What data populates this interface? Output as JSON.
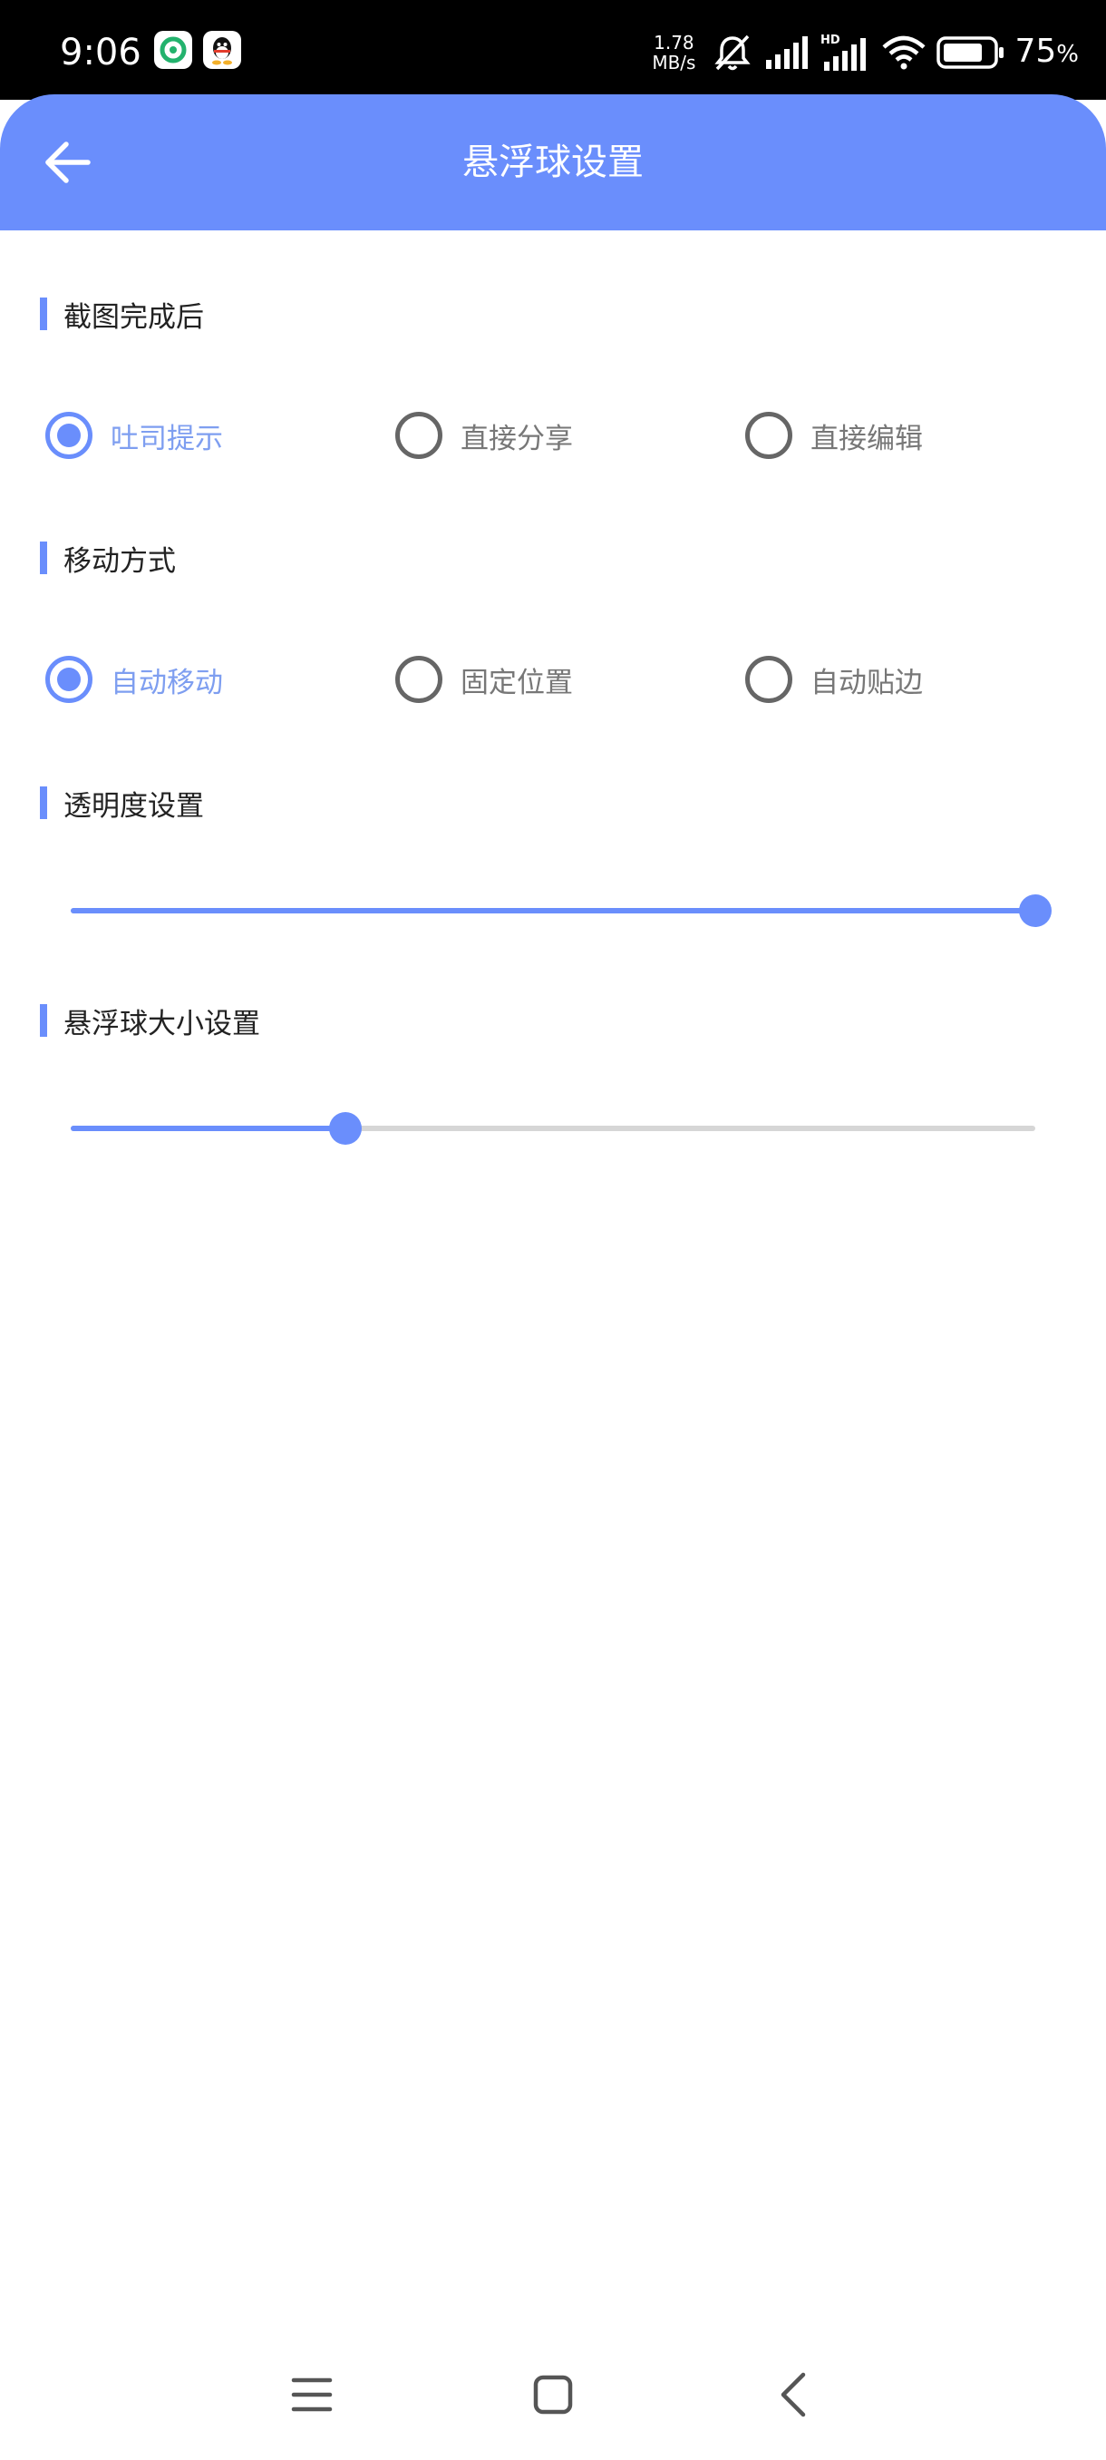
{
  "status_bar": {
    "time": "9:06",
    "net_speed_value": "1.78",
    "net_speed_unit": "MB/s",
    "battery_level": "75",
    "battery_unit": "%",
    "battery_fraction": 0.75,
    "icons": [
      "app-icon-green",
      "qq-icon",
      "mute-bell-icon",
      "signal-icon",
      "hd-signal-icon",
      "wifi-icon",
      "battery-icon"
    ]
  },
  "app_bar": {
    "title": "悬浮球设置",
    "back_icon": "back-arrow-icon"
  },
  "sections": {
    "after_screenshot": {
      "title": "截图完成后",
      "options": [
        "吐司提示",
        "直接分享",
        "直接编辑"
      ],
      "selected": "吐司提示"
    },
    "move_mode": {
      "title": "移动方式",
      "options": [
        "自动移动",
        "固定位置",
        "自动贴边"
      ],
      "selected": "自动移动"
    },
    "opacity": {
      "title": "透明度设置",
      "value_fraction": 1.0
    },
    "ball_size": {
      "title": "悬浮球大小设置",
      "value_fraction": 0.285
    }
  },
  "nav_bar": {
    "icons": [
      "menu-icon",
      "home-icon",
      "back-icon"
    ]
  },
  "colors": {
    "accent": "#6a8efc",
    "selected_text": "#7e9ef0",
    "unselected": "#666666",
    "track": "#d6d6d6"
  }
}
